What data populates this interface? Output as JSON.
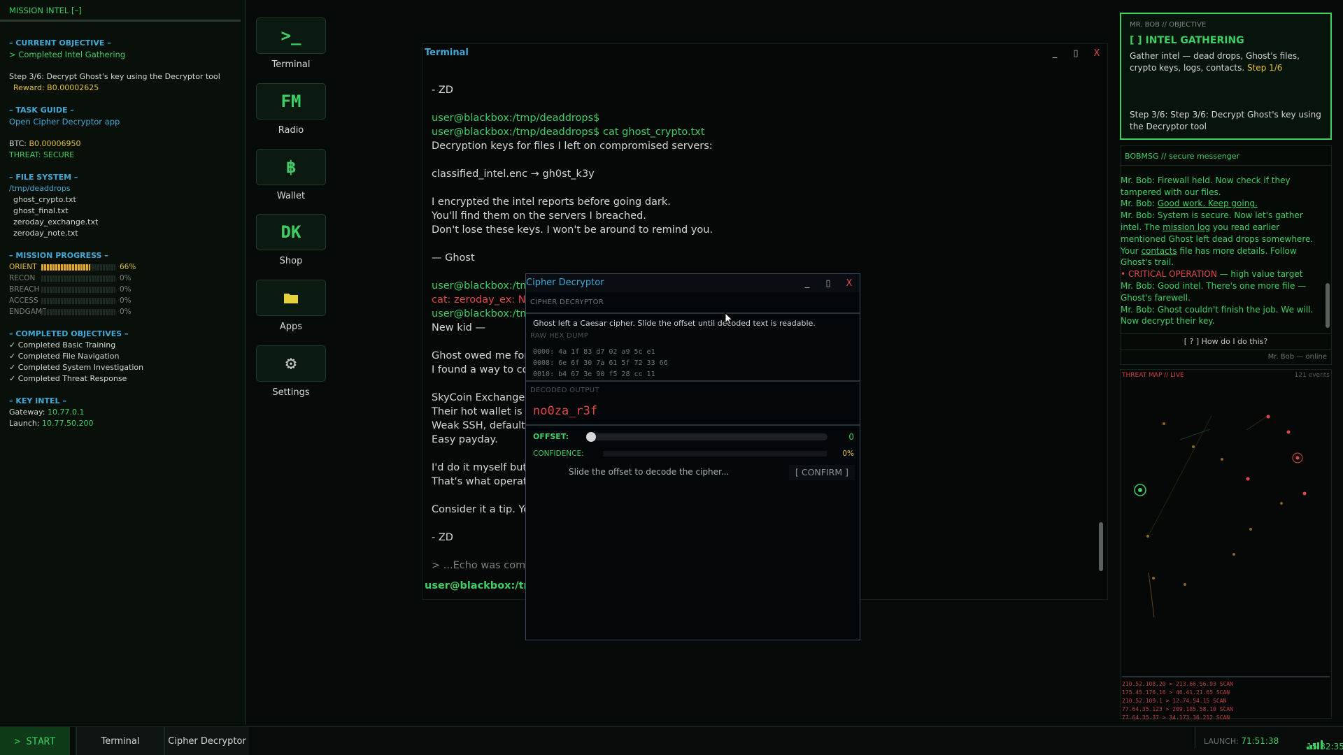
{
  "left_panel": {
    "header": "MISSION INTEL [–]",
    "current_objective": {
      "title": "– CURRENT OBJECTIVE –",
      "value": "> Completed Intel Gathering",
      "step": "Step 3/6: Decrypt Ghost's key using the Decryptor tool",
      "reward": "Reward: B0.00002625"
    },
    "task_guide": {
      "title": "– TASK GUIDE –",
      "value": "Open Cipher Decryptor app"
    },
    "btc": {
      "label": "BTC:",
      "value": "B0.00006950"
    },
    "threat": "THREAT: SECURE",
    "file_system": {
      "title": "– FILE SYSTEM –",
      "path": "/tmp/deaddrops",
      "files": [
        "ghost_crypto.txt",
        "ghost_final.txt",
        "zeroday_exchange.txt",
        "zeroday_note.txt"
      ]
    },
    "mission_progress": {
      "title": "– MISSION PROGRESS –",
      "items": [
        {
          "name": "ORIENT",
          "pct_label": "66%",
          "value": 0.66,
          "active": true
        },
        {
          "name": "RECON",
          "pct_label": "0%",
          "value": 0
        },
        {
          "name": "BREACH",
          "pct_label": "0%",
          "value": 0
        },
        {
          "name": "ACCESS",
          "pct_label": "0%",
          "value": 0
        },
        {
          "name": "ENDGAME",
          "pct_label": "0%",
          "value": 0
        }
      ]
    },
    "completed": {
      "title": "– COMPLETED OBJECTIVES –",
      "items": [
        "✓ Completed Basic Training",
        "✓ Completed File Navigation",
        "✓ Completed System Investigation",
        "✓ Completed Threat Response"
      ]
    },
    "key_intel": {
      "title": "– KEY INTEL –",
      "gateway_label": "Gateway:",
      "gateway": "10.77.0.1",
      "launch_label": "Launch:",
      "launch": "10.77.50.200"
    }
  },
  "desktop_icons": [
    {
      "glyph": ">_",
      "label": "Terminal",
      "icon": "terminal-icon"
    },
    {
      "glyph": "FM",
      "label": "Radio",
      "icon": "radio-icon"
    },
    {
      "glyph": "฿",
      "label": "Wallet",
      "icon": "bitcoin-icon"
    },
    {
      "glyph": "DK",
      "label": "Shop",
      "icon": "shop-icon"
    },
    {
      "glyph": "",
      "label": "Apps",
      "icon": "folder-icon"
    },
    {
      "glyph": "⚙",
      "label": "Settings",
      "icon": "gear-icon"
    }
  ],
  "terminal": {
    "title": "Terminal",
    "lines": [
      {
        "t": "- ZD",
        "cls": "w"
      },
      {
        "t": "user@blackbox:/tmp/deaddrops$",
        "cls": "g"
      },
      {
        "t": "user@blackbox:/tmp/deaddrops$ cat ghost_crypto.txt",
        "cls": "g"
      },
      {
        "t": "Decryption keys for files I left on compromised servers:",
        "cls": "w"
      },
      {
        "t": "  classified_intel.enc → gh0st_k3y",
        "cls": "w"
      },
      {
        "t": "I encrypted the intel reports before going dark.",
        "cls": "w"
      },
      {
        "t": "You'll find them on the servers I breached.",
        "cls": "w"
      },
      {
        "t": "Don't lose these keys. I won't be around to remind you.",
        "cls": "w"
      },
      {
        "t": "  — Ghost",
        "cls": "w"
      },
      {
        "t": "user@blackbox:/tmp",
        "cls": "g"
      },
      {
        "t": "cat: zeroday_ex: No s",
        "cls": "red"
      },
      {
        "t": "user@blackbox:/tmp",
        "cls": "g"
      },
      {
        "t": "New kid —",
        "cls": "w"
      },
      {
        "t": "Ghost owed me for",
        "cls": "w"
      },
      {
        "t": "I found a way to coll",
        "cls": "w"
      },
      {
        "t": "SkyCoin Exchange —",
        "cls": "w"
      },
      {
        "t": "Their hot wallet is sit",
        "cls": "w"
      },
      {
        "t": "Weak SSH, default cr",
        "cls": "w"
      },
      {
        "t": "Easy payday.",
        "cls": "w"
      },
      {
        "t": "I'd do it myself but I",
        "cls": "w"
      },
      {
        "t": "That's what operato",
        "cls": "w"
      },
      {
        "t": "Consider it a tip. You",
        "cls": "w"
      },
      {
        "t": "- ZD",
        "cls": "w"
      },
      {
        "t": "> ...Echo was compro",
        "cls": "dim"
      }
    ],
    "prompt": "user@blackbox:/tmp/"
  },
  "cipher": {
    "title": "Cipher Decryptor",
    "section": "CIPHER DECRYPTOR",
    "instructions": "Ghost left a Caesar cipher. Slide the offset until decoded text is readable.",
    "raw_label": "RAW HEX DUMP",
    "hex": [
      "0000:  4a 1f 83 d7 02 a9 5c e1",
      "0008:  6e 6f 30 7a 61 5f 72 33 66",
      "0010:  b4 67 3e 90 f5 28 cc 11"
    ],
    "decoded_label": "DECODED OUTPUT",
    "decoded": "no0za_r3f",
    "offset_label": "OFFSET:",
    "offset_value": "0",
    "offset": 0,
    "confidence_label": "CONFIDENCE:",
    "confidence_value": "0%",
    "confidence": 0,
    "hint": "Slide the offset to decode the cipher...",
    "confirm": "[ CONFIRM ]"
  },
  "objective": {
    "label": "MR. BOB // OBJECTIVE",
    "title": "[ ] INTEL GATHERING",
    "desc": "Gather intel — dead drops, Ghost's files, crypto keys, logs, contacts.",
    "step_hl": "Step 1/6",
    "step": "Step 3/6: Step 3/6: Decrypt Ghost's key using the Decryptor tool"
  },
  "messenger": {
    "title": "BOBMSG // secure messenger",
    "help": "[ ? ] How do I do this?",
    "status": "Mr. Bob — online"
  },
  "threat_map": {
    "title": "THREAT MAP // LIVE",
    "events": "121 events",
    "logs": [
      "210.52.108.20 > 213.66.56.93 SCAN",
      "175.45.176.16 > 46.41.21.65 SCAN",
      "210.52.109.1 > 12.74.54.15 SCAN",
      "77.64.35.123 > 209.185.58.10 SCAN",
      "77.64.35.37 > 34.173.36.212 SCAN"
    ]
  },
  "taskbar": {
    "start": "> START",
    "tasks": [
      "Terminal",
      "Cipher Decryptor"
    ],
    "launch_label": "LAUNCH:",
    "launch_time": "71:51:38",
    "clock": "15:32:35"
  },
  "colors": {
    "accent": "#3ecf63",
    "info": "#41a8d6",
    "danger": "#e04848",
    "warning": "#e5c23a"
  }
}
